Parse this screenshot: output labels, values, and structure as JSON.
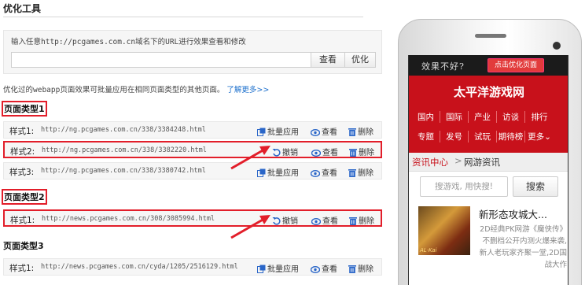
{
  "page_title": "优化工具",
  "edit": {
    "label": "输入任意http://pcgames.com.cn域名下的URL进行效果查看和修改",
    "url_value": "",
    "view_button": "查看",
    "optimize_button": "优化"
  },
  "intro": {
    "text": "优化过的webapp页面效果可批量应用在相同页面类型的其他页面。",
    "link": "了解更多>>"
  },
  "actions": {
    "batch": "批量应用",
    "undo": "撤销",
    "view": "查看",
    "delete": "删除"
  },
  "groups": [
    {
      "title": "页面类型1",
      "rows": [
        {
          "label": "样式1:",
          "url": "http://ng.pcgames.com.cn/338/3384248.html"
        },
        {
          "label": "样式2:",
          "url": "http://ng.pcgames.com.cn/338/3382220.html"
        },
        {
          "label": "样式3:",
          "url": "http://ng.pcgames.com.cn/338/3380742.html"
        }
      ]
    },
    {
      "title": "页面类型2",
      "rows": [
        {
          "label": "样式1:",
          "url": "http://news.pcgames.com.cn/308/3085994.html"
        }
      ]
    },
    {
      "title": "页面类型3",
      "rows": [
        {
          "label": "样式1:",
          "url": "http://news.pcgames.com.cn/cyda/1205/2516129.html"
        }
      ]
    }
  ],
  "phone": {
    "bad_text": "效果不好?",
    "optimize_page_button": "点击优化页面",
    "site_title": "太平洋游戏网",
    "nav_row1": [
      "国内",
      "国际",
      "产业",
      "访谈",
      "排行"
    ],
    "nav_row2": [
      "专题",
      "发号",
      "试玩",
      "期待榜",
      "更多"
    ],
    "crumb_home": "资讯中心",
    "crumb_sep": ">",
    "crumb_current": "网游资讯",
    "search_placeholder": "搜游戏, 用快搜!",
    "search_button": "搜索",
    "thumb_caption": "AL·Kai",
    "news_title": "新形态攻城大...",
    "news_body": "2D经典PK网游《魔侠传》不删档公开内测火爆来袭,新人老玩家齐聚一堂,2D国战大作"
  },
  "colors": {
    "highlight": "#e21e2a",
    "brand_red": "#c8111b",
    "link": "#1a6ecc"
  }
}
